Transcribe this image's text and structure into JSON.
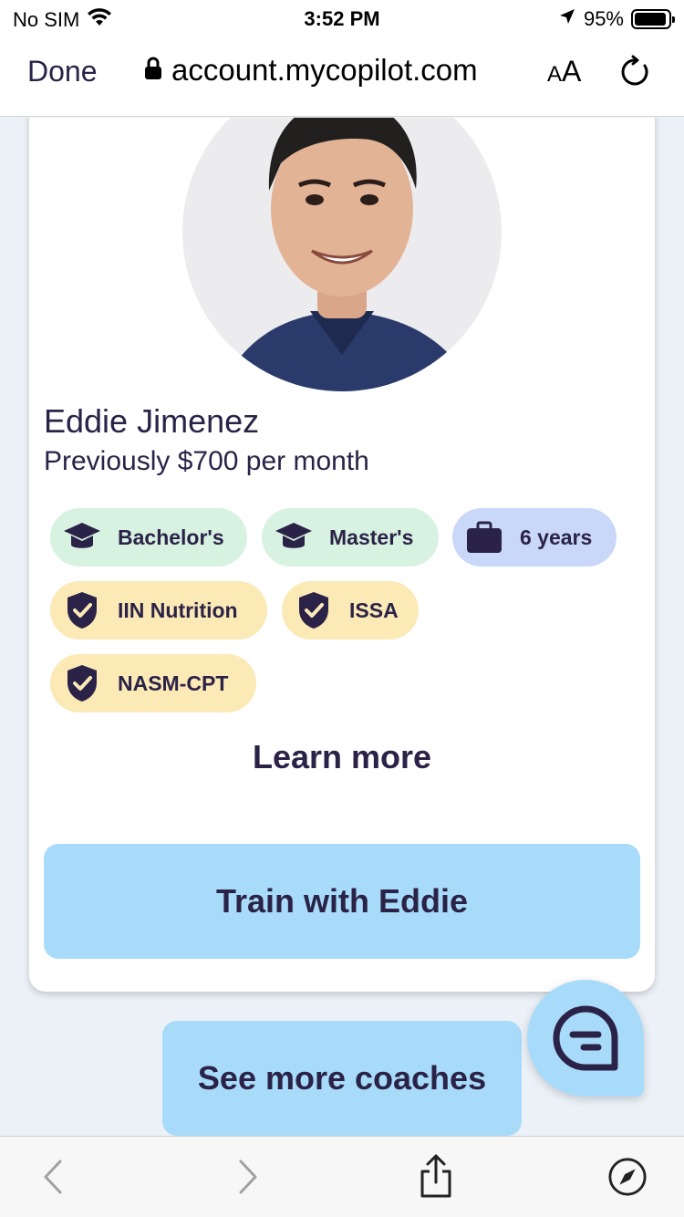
{
  "status_bar": {
    "carrier": "No SIM",
    "time": "3:52 PM",
    "battery_percent": "95%",
    "battery_level": 0.95
  },
  "browser": {
    "done_label": "Done",
    "url": "account.mycopilot.com",
    "text_size_label_small": "A",
    "text_size_label_large": "A"
  },
  "coach": {
    "name": "Eddie Jimenez",
    "price": "Previously $700 per month",
    "credentials": [
      {
        "label": "Bachelor's",
        "icon": "graduation-cap-icon",
        "kind": "education"
      },
      {
        "label": "Master's",
        "icon": "graduation-cap-icon",
        "kind": "education"
      },
      {
        "label": "6 years",
        "icon": "briefcase-icon",
        "kind": "experience"
      },
      {
        "label": "IIN Nutrition",
        "icon": "shield-check-icon",
        "kind": "certification"
      },
      {
        "label": "ISSA",
        "icon": "shield-check-icon",
        "kind": "certification"
      },
      {
        "label": "NASM-CPT",
        "icon": "shield-check-icon",
        "kind": "certification"
      }
    ],
    "learn_more_label": "Learn more",
    "train_label": "Train with Eddie"
  },
  "page": {
    "see_more_label": "See more coaches"
  },
  "colors": {
    "primary_text": "#2b2347",
    "button_blue": "#a8dbf9",
    "chip_green": "#d8f2e2",
    "chip_blue": "#c9d8f8",
    "chip_yellow": "#fbe9b6",
    "page_bg": "#ecf1f8"
  }
}
